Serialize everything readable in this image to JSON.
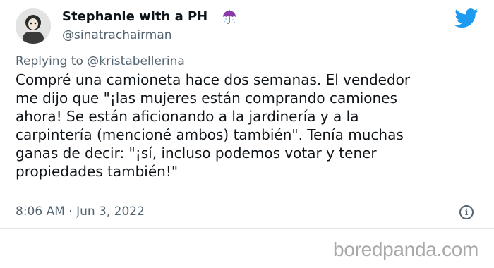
{
  "tweet": {
    "display_name": "Stephanie with a PH",
    "name_emoji": "umbrella-icon",
    "handle": "@sinatrachairman",
    "reply": {
      "prefix": "Replying to ",
      "user": "@kristabellerina"
    },
    "text_lines": [
      "Compré una camioneta hace dos semanas. El vendedor",
      "me dijo que \"¡las mujeres están comprando camiones",
      "ahora! Se están aficionando a la jardinería y a la",
      "carpintería (mencioné ambos) también\". Tenía muchas",
      "ganas de decir: \"¡sí, incluso podemos votar y tener",
      "propiedades también!\""
    ],
    "timestamp": "8:06 AM · Jun 3, 2022",
    "info_icon_glyph": "i"
  },
  "watermark": "boredpanda.com",
  "colors": {
    "text": "#0f1419",
    "secondary": "#536471",
    "twitter_blue": "#1d9bf0",
    "umbrella": "#8a3aa6",
    "watermark": "#a9a9a9"
  },
  "icons": {
    "twitter": "twitter-bird-icon",
    "info": "info-icon",
    "avatar": "avatar"
  }
}
